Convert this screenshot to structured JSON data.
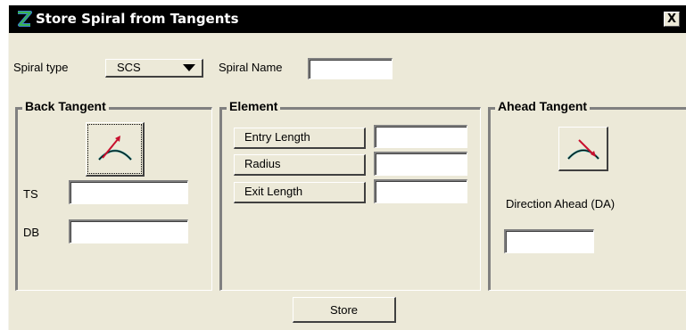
{
  "window": {
    "title": "Store Spiral from Tangents",
    "close_label": "X"
  },
  "top": {
    "spiral_type_label": "Spiral type",
    "spiral_type_value": "SCS",
    "spiral_name_label": "Spiral Name",
    "spiral_name_value": ""
  },
  "back_tangent": {
    "title": "Back Tangent",
    "icon": "back-tangent-icon",
    "ts_label": "TS",
    "ts_value": "",
    "db_label": "DB",
    "db_value": ""
  },
  "element": {
    "title": "Element",
    "rows": [
      {
        "label": "Entry Length",
        "value": ""
      },
      {
        "label": "Radius",
        "value": ""
      },
      {
        "label": "Exit Length",
        "value": ""
      }
    ]
  },
  "ahead_tangent": {
    "title": "Ahead Tangent",
    "icon": "ahead-tangent-icon",
    "da_label": "Direction Ahead (DA)",
    "da_value": ""
  },
  "footer": {
    "store_label": "Store"
  },
  "colors": {
    "dialog_bg": "#ece9d8",
    "titlebar_bg": "#000000",
    "icon_red": "#c8102e",
    "icon_teal": "#2f8f8f"
  }
}
